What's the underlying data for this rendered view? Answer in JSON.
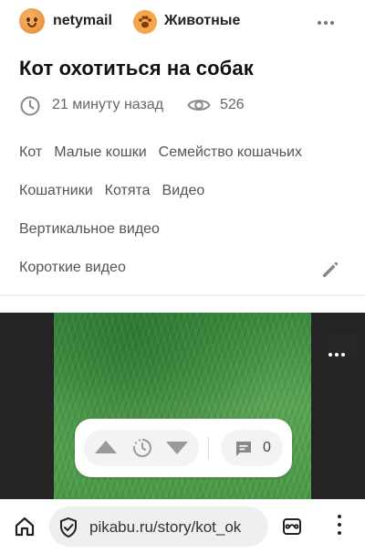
{
  "header": {
    "username": "netymail",
    "community": "Животные",
    "avatar_icon": "smiley-avatar-icon",
    "community_icon": "paw-icon",
    "more_icon": "more-dots-icon"
  },
  "post": {
    "title": "Кот охотиться на собак",
    "time_ago": "21 минуту назад",
    "views": "526",
    "tags": [
      [
        "Кот",
        "Малые кошки",
        "Семейство кошачьих"
      ],
      [
        "Кошатники",
        "Котята",
        "Видео"
      ],
      [
        "Вертикальное видео"
      ],
      [
        "Короткие видео"
      ]
    ]
  },
  "actions": {
    "comment_count": "0"
  },
  "browser": {
    "url": "pikabu.ru/story/kot_ok"
  },
  "colors": {
    "accent_orange": "#f5a44a",
    "grass_green": "#4c9a48",
    "muted_text": "#666666"
  }
}
